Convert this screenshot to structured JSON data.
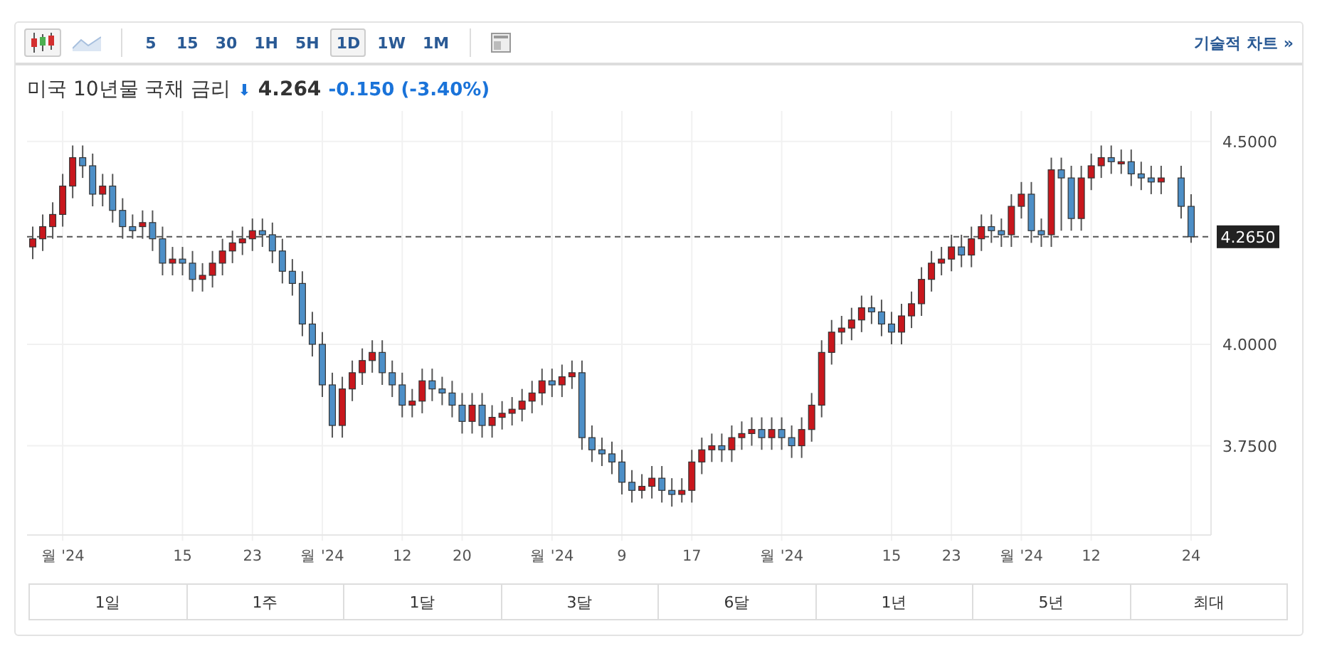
{
  "toolbar": {
    "chart_types": [
      {
        "kind": "candles",
        "selected": true
      },
      {
        "kind": "area",
        "selected": false
      }
    ],
    "intervals": [
      {
        "label": "5",
        "selected": false
      },
      {
        "label": "15",
        "selected": false
      },
      {
        "label": "30",
        "selected": false
      },
      {
        "label": "1H",
        "selected": false
      },
      {
        "label": "5H",
        "selected": false
      },
      {
        "label": "1D",
        "selected": true
      },
      {
        "label": "1W",
        "selected": false
      },
      {
        "label": "1M",
        "selected": false
      }
    ],
    "technical_link": "기술적 차트 »"
  },
  "quote": {
    "name": "미국 10년물 국채 금리",
    "arrow": "⬇",
    "price": "4.264",
    "change": "-0.150 (-3.40%)"
  },
  "chart_data": {
    "type": "candlestick",
    "ylim": [
      3.53,
      4.575
    ],
    "grid": true,
    "yticks": [
      {
        "value": 3.75,
        "label": "3.7500"
      },
      {
        "value": 4.0,
        "label": "4.0000"
      },
      {
        "value": 4.5,
        "label": "4.5000"
      }
    ],
    "categories": [
      null,
      null,
      null,
      "월 '24",
      null,
      null,
      null,
      null,
      null,
      null,
      null,
      null,
      null,
      null,
      null,
      "15",
      null,
      null,
      null,
      null,
      null,
      null,
      "23",
      null,
      null,
      null,
      null,
      null,
      null,
      "월 '24",
      null,
      null,
      null,
      null,
      null,
      null,
      null,
      "12",
      null,
      null,
      null,
      null,
      null,
      "20",
      null,
      null,
      null,
      null,
      null,
      null,
      null,
      null,
      "월 '24",
      null,
      null,
      null,
      null,
      null,
      null,
      "9",
      null,
      null,
      null,
      null,
      null,
      null,
      "17",
      null,
      null,
      null,
      null,
      null,
      null,
      null,
      null,
      "월 '24",
      null,
      null,
      null,
      null,
      null,
      null,
      null,
      null,
      null,
      null,
      "15",
      null,
      null,
      null,
      null,
      null,
      "23",
      null,
      null,
      null,
      null,
      null,
      null,
      "월 '24",
      null,
      null,
      null,
      null,
      null,
      null,
      "12",
      null,
      null,
      null,
      null,
      null,
      null,
      null,
      null,
      null,
      "24"
    ],
    "ohlc": [
      [
        4.24,
        4.29,
        4.21,
        4.26
      ],
      [
        4.26,
        4.32,
        4.23,
        4.29
      ],
      [
        4.29,
        4.35,
        4.26,
        4.32
      ],
      [
        4.32,
        4.42,
        4.29,
        4.39
      ],
      [
        4.39,
        4.49,
        4.36,
        4.46
      ],
      [
        4.46,
        4.49,
        4.41,
        4.44
      ],
      [
        4.44,
        4.47,
        4.34,
        4.37
      ],
      [
        4.37,
        4.42,
        4.34,
        4.39
      ],
      [
        4.39,
        4.42,
        4.3,
        4.33
      ],
      [
        4.33,
        4.36,
        4.26,
        4.29
      ],
      [
        4.29,
        4.32,
        4.26,
        4.28
      ],
      [
        4.29,
        4.33,
        4.26,
        4.3
      ],
      [
        4.3,
        4.33,
        4.23,
        4.26
      ],
      [
        4.26,
        4.29,
        4.17,
        4.2
      ],
      [
        4.2,
        4.24,
        4.17,
        4.21
      ],
      [
        4.21,
        4.24,
        4.17,
        4.2
      ],
      [
        4.2,
        4.23,
        4.13,
        4.16
      ],
      [
        4.16,
        4.2,
        4.13,
        4.17
      ],
      [
        4.17,
        4.23,
        4.14,
        4.2
      ],
      [
        4.2,
        4.26,
        4.17,
        4.23
      ],
      [
        4.23,
        4.28,
        4.2,
        4.25
      ],
      [
        4.25,
        4.29,
        4.22,
        4.26
      ],
      [
        4.26,
        4.31,
        4.23,
        4.28
      ],
      [
        4.28,
        4.31,
        4.24,
        4.27
      ],
      [
        4.27,
        4.3,
        4.2,
        4.23
      ],
      [
        4.23,
        4.26,
        4.15,
        4.18
      ],
      [
        4.18,
        4.21,
        4.12,
        4.15
      ],
      [
        4.15,
        4.18,
        4.02,
        4.05
      ],
      [
        4.05,
        4.08,
        3.97,
        4.0
      ],
      [
        4.0,
        4.03,
        3.87,
        3.9
      ],
      [
        3.9,
        3.93,
        3.77,
        3.8
      ],
      [
        3.8,
        3.92,
        3.77,
        3.89
      ],
      [
        3.89,
        3.96,
        3.86,
        3.93
      ],
      [
        3.93,
        3.99,
        3.9,
        3.96
      ],
      [
        3.96,
        4.01,
        3.93,
        3.98
      ],
      [
        3.98,
        4.01,
        3.9,
        3.93
      ],
      [
        3.93,
        3.96,
        3.87,
        3.9
      ],
      [
        3.9,
        3.93,
        3.82,
        3.85
      ],
      [
        3.85,
        3.89,
        3.82,
        3.86
      ],
      [
        3.86,
        3.94,
        3.83,
        3.91
      ],
      [
        3.91,
        3.94,
        3.86,
        3.89
      ],
      [
        3.89,
        3.92,
        3.85,
        3.88
      ],
      [
        3.88,
        3.91,
        3.82,
        3.85
      ],
      [
        3.85,
        3.88,
        3.78,
        3.81
      ],
      [
        3.81,
        3.88,
        3.78,
        3.85
      ],
      [
        3.85,
        3.88,
        3.77,
        3.8
      ],
      [
        3.8,
        3.85,
        3.77,
        3.82
      ],
      [
        3.82,
        3.86,
        3.79,
        3.83
      ],
      [
        3.83,
        3.87,
        3.8,
        3.84
      ],
      [
        3.84,
        3.89,
        3.81,
        3.86
      ],
      [
        3.86,
        3.91,
        3.83,
        3.88
      ],
      [
        3.88,
        3.94,
        3.85,
        3.91
      ],
      [
        3.91,
        3.94,
        3.87,
        3.9
      ],
      [
        3.9,
        3.95,
        3.87,
        3.92
      ],
      [
        3.92,
        3.96,
        3.89,
        3.93
      ],
      [
        3.93,
        3.96,
        3.74,
        3.77
      ],
      [
        3.77,
        3.8,
        3.71,
        3.74
      ],
      [
        3.74,
        3.77,
        3.7,
        3.73
      ],
      [
        3.73,
        3.76,
        3.68,
        3.71
      ],
      [
        3.71,
        3.74,
        3.63,
        3.66
      ],
      [
        3.66,
        3.69,
        3.61,
        3.64
      ],
      [
        3.64,
        3.68,
        3.62,
        3.65
      ],
      [
        3.65,
        3.7,
        3.62,
        3.67
      ],
      [
        3.67,
        3.7,
        3.61,
        3.64
      ],
      [
        3.64,
        3.67,
        3.6,
        3.63
      ],
      [
        3.63,
        3.67,
        3.61,
        3.64
      ],
      [
        3.64,
        3.74,
        3.61,
        3.71
      ],
      [
        3.71,
        3.77,
        3.68,
        3.74
      ],
      [
        3.74,
        3.78,
        3.71,
        3.75
      ],
      [
        3.75,
        3.78,
        3.71,
        3.74
      ],
      [
        3.74,
        3.8,
        3.71,
        3.77
      ],
      [
        3.77,
        3.81,
        3.74,
        3.78
      ],
      [
        3.78,
        3.82,
        3.75,
        3.79
      ],
      [
        3.79,
        3.82,
        3.74,
        3.77
      ],
      [
        3.77,
        3.82,
        3.74,
        3.79
      ],
      [
        3.79,
        3.82,
        3.74,
        3.77
      ],
      [
        3.77,
        3.8,
        3.72,
        3.75
      ],
      [
        3.75,
        3.82,
        3.72,
        3.79
      ],
      [
        3.79,
        3.88,
        3.76,
        3.85
      ],
      [
        3.85,
        4.01,
        3.82,
        3.98
      ],
      [
        3.98,
        4.06,
        3.95,
        4.03
      ],
      [
        4.03,
        4.07,
        4.0,
        4.04
      ],
      [
        4.04,
        4.09,
        4.01,
        4.06
      ],
      [
        4.06,
        4.12,
        4.03,
        4.09
      ],
      [
        4.09,
        4.12,
        4.05,
        4.08
      ],
      [
        4.08,
        4.11,
        4.02,
        4.05
      ],
      [
        4.05,
        4.08,
        4.0,
        4.03
      ],
      [
        4.03,
        4.1,
        4.0,
        4.07
      ],
      [
        4.07,
        4.13,
        4.04,
        4.1
      ],
      [
        4.1,
        4.19,
        4.07,
        4.16
      ],
      [
        4.16,
        4.23,
        4.13,
        4.2
      ],
      [
        4.2,
        4.24,
        4.17,
        4.21
      ],
      [
        4.21,
        4.27,
        4.18,
        4.24
      ],
      [
        4.24,
        4.27,
        4.19,
        4.22
      ],
      [
        4.22,
        4.29,
        4.19,
        4.26
      ],
      [
        4.26,
        4.32,
        4.23,
        4.29
      ],
      [
        4.29,
        4.32,
        4.25,
        4.28
      ],
      [
        4.28,
        4.31,
        4.24,
        4.27
      ],
      [
        4.27,
        4.37,
        4.24,
        4.34
      ],
      [
        4.34,
        4.4,
        4.31,
        4.37
      ],
      [
        4.37,
        4.4,
        4.25,
        4.28
      ],
      [
        4.28,
        4.31,
        4.24,
        4.27
      ],
      [
        4.27,
        4.46,
        4.24,
        4.43
      ],
      [
        4.43,
        4.46,
        4.28,
        4.41
      ],
      [
        4.41,
        4.44,
        4.28,
        4.31
      ],
      [
        4.31,
        4.44,
        4.28,
        4.41
      ],
      [
        4.41,
        4.47,
        4.38,
        4.44
      ],
      [
        4.44,
        4.49,
        4.41,
        4.46
      ],
      [
        4.46,
        4.49,
        4.42,
        4.45
      ],
      [
        4.45,
        4.48,
        4.42,
        4.45
      ],
      [
        4.45,
        4.48,
        4.39,
        4.42
      ],
      [
        4.42,
        4.45,
        4.38,
        4.41
      ],
      [
        4.41,
        4.44,
        4.37,
        4.4
      ],
      [
        4.4,
        4.44,
        4.37,
        4.41
      ],
      null,
      [
        4.41,
        4.44,
        4.31,
        4.34
      ],
      [
        4.34,
        4.37,
        4.25,
        4.265
      ]
    ],
    "ref_lines": [
      {
        "axis": "y",
        "value": 4.265,
        "label": "4.2650"
      }
    ]
  },
  "ranges": [
    {
      "label": "1일"
    },
    {
      "label": "1주"
    },
    {
      "label": "1달"
    },
    {
      "label": "3달"
    },
    {
      "label": "6달"
    },
    {
      "label": "1년"
    },
    {
      "label": "5년"
    },
    {
      "label": "최대"
    }
  ]
}
